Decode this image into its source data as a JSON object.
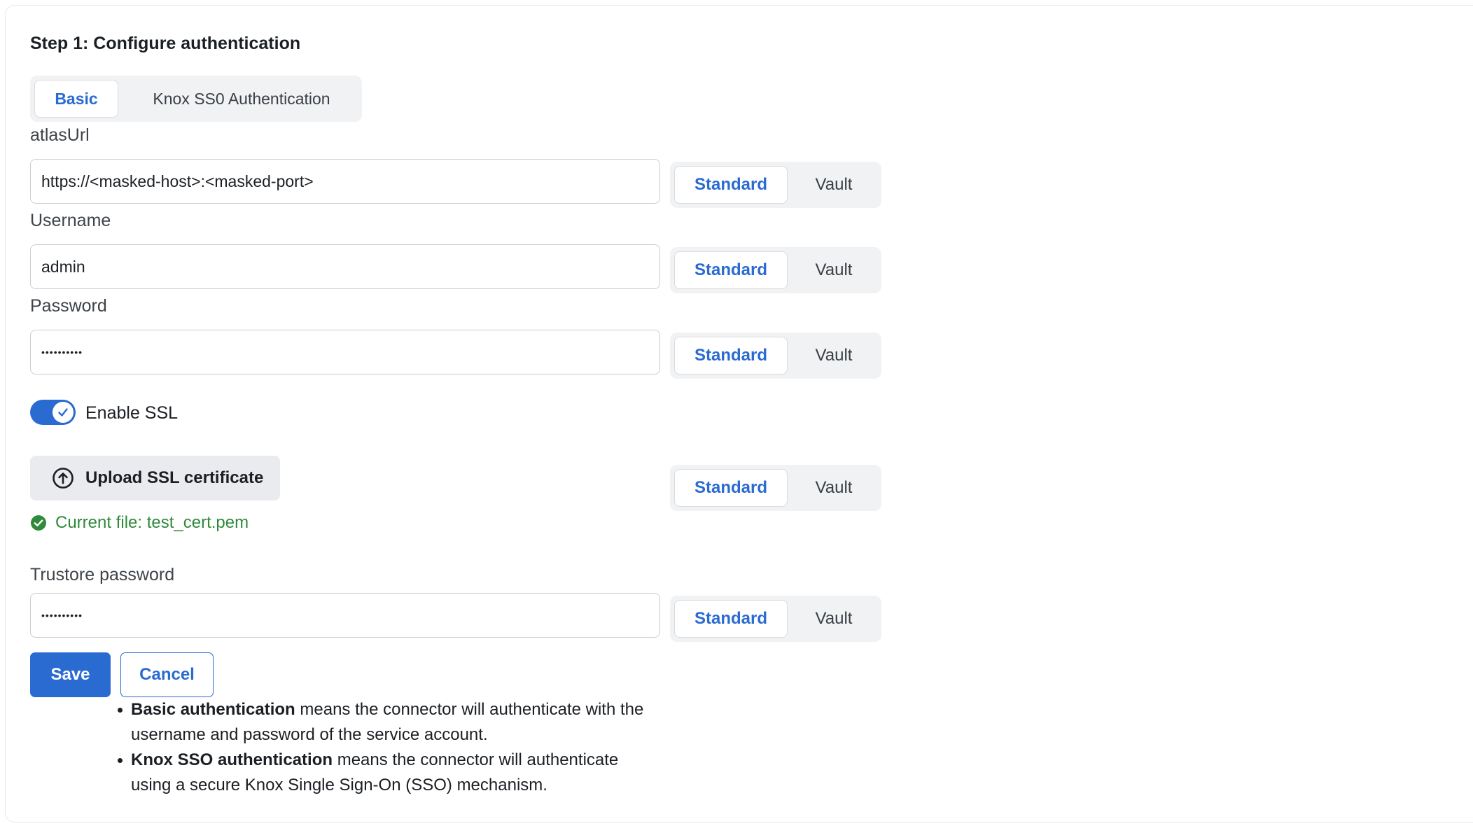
{
  "page": {
    "step_title": "Step 1: Configure authentication"
  },
  "auth_tabs": {
    "basic": "Basic",
    "knox": "Knox SS0 Authentication",
    "selected": "Basic"
  },
  "fields": {
    "atlas_url": {
      "label": "atlasUrl",
      "value": "https://<masked-host>:<masked-port>"
    },
    "username": {
      "label": "Username",
      "value": "admin"
    },
    "password": {
      "label": "Password",
      "value": "••••••••••"
    },
    "truststore_password": {
      "label": "Trustore password",
      "value": "••••••••••"
    }
  },
  "source_toggle": {
    "standard": "Standard",
    "vault": "Vault",
    "selected": "Standard"
  },
  "ssl": {
    "toggle_label": "Enable SSL",
    "enabled": true,
    "upload_label": "Upload SSL certificate",
    "current_file": "Current file: test_cert.pem"
  },
  "actions": {
    "save": "Save",
    "cancel": "Cancel"
  },
  "help": {
    "basic_title": "Basic authentication",
    "basic_text": " means the connector will authenticate with the username and password of the service account.",
    "knox_title": "Knox SSO authentication",
    "knox_text": " means the connector will authenticate using a secure Knox Single Sign-On (SSO) mechanism."
  },
  "colors": {
    "accent": "#2a6bd1",
    "success": "#2f8a3a",
    "segment_bg": "#f1f2f4"
  },
  "icons": {
    "upload": "upload-circle-arrow-icon",
    "check": "check-circle-icon",
    "toggle_check": "checkmark-icon"
  }
}
